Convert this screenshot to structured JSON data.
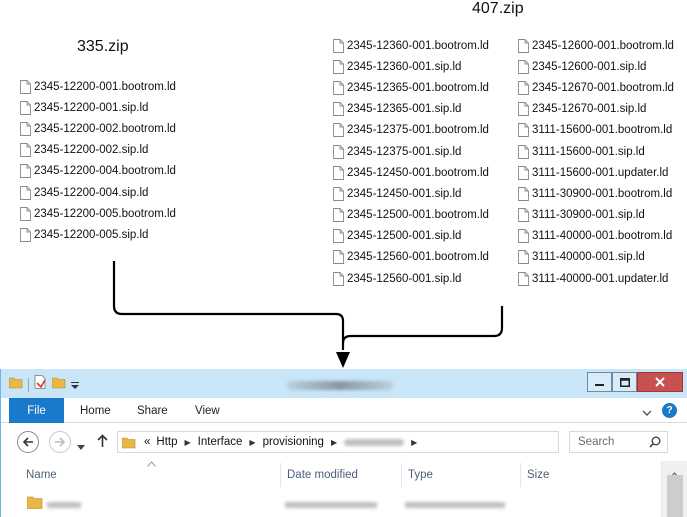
{
  "zip_left": {
    "title": "335.zip",
    "files": [
      "2345-12200-001.bootrom.ld",
      "2345-12200-001.sip.ld",
      "2345-12200-002.bootrom.ld",
      "2345-12200-002.sip.ld",
      "2345-12200-004.bootrom.ld",
      "2345-12200-004.sip.ld",
      "2345-12200-005.bootrom.ld",
      "2345-12200-005.sip.ld"
    ]
  },
  "zip_right": {
    "title": "407.zip",
    "files_col1": [
      "2345-12360-001.bootrom.ld",
      "2345-12360-001.sip.ld",
      "2345-12365-001.bootrom.ld",
      "2345-12365-001.sip.ld",
      "2345-12375-001.bootrom.ld",
      "2345-12375-001.sip.ld",
      "2345-12450-001.bootrom.ld",
      "2345-12450-001.sip.ld",
      "2345-12500-001.bootrom.ld",
      "2345-12500-001.sip.ld",
      "2345-12560-001.bootrom.ld",
      "2345-12560-001.sip.ld"
    ],
    "files_col2": [
      "2345-12600-001.bootrom.ld",
      "2345-12600-001.sip.ld",
      "2345-12670-001.bootrom.ld",
      "2345-12670-001.sip.ld",
      "3111-15600-001.bootrom.ld",
      "3111-15600-001.sip.ld",
      "3111-15600-001.updater.ld",
      "3111-30900-001.bootrom.ld",
      "3111-30900-001.sip.ld",
      "3111-40000-001.bootrom.ld",
      "3111-40000-001.sip.ld",
      "3111-40000-001.updater.ld"
    ]
  },
  "explorer": {
    "ribbon_tabs": {
      "file": "File",
      "home": "Home",
      "share": "Share",
      "view": "View"
    },
    "breadcrumb": {
      "prefix": "«",
      "items": [
        "Http",
        "Interface",
        "provisioning"
      ]
    },
    "search": {
      "placeholder": "Search"
    },
    "columns": {
      "name": "Name",
      "date_modified": "Date modified",
      "type": "Type",
      "size": "Size"
    },
    "colors": {
      "titlebar": "#c8e6f7",
      "file_tab": "#1979ca",
      "close_button": "#c75050",
      "column_header_text": "#4c607a",
      "folder": "#e8b846"
    },
    "icons": [
      "folder-icon",
      "document-icon",
      "dropdown-icon",
      "minimize-icon",
      "maximize-icon",
      "close-icon",
      "back-arrow-icon",
      "forward-arrow-icon",
      "up-arrow-icon",
      "refresh-icon",
      "search-icon",
      "help-icon"
    ]
  }
}
